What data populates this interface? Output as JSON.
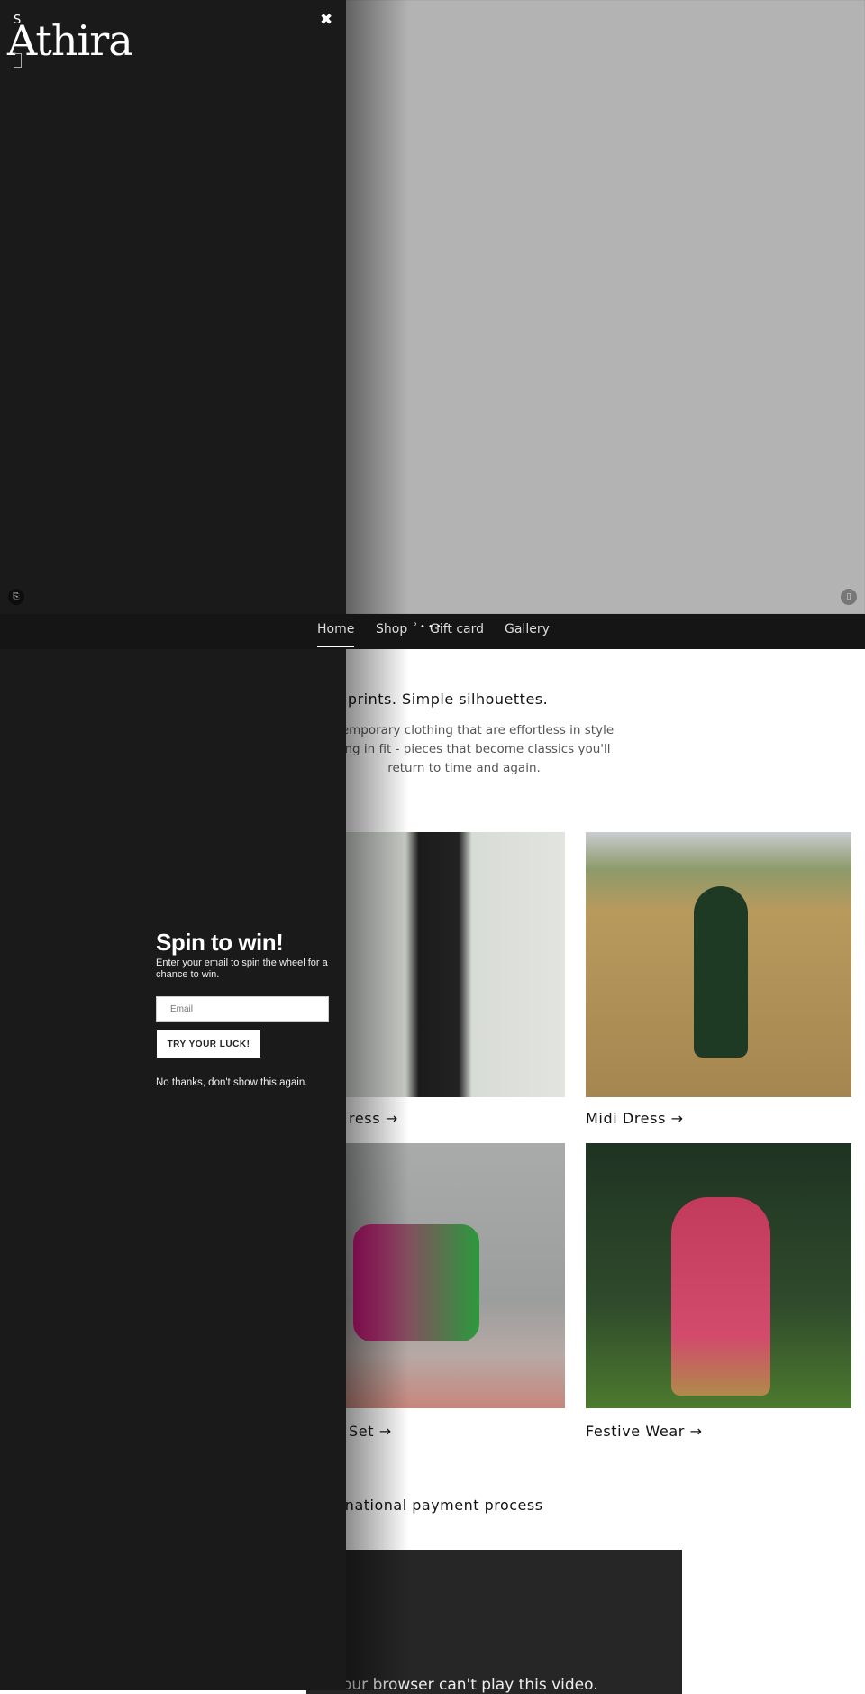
{
  "drawer": {
    "logo": "Athira",
    "s_mark": "S",
    "close_label": "✖",
    "icon_label": "⎘"
  },
  "hero": {
    "button_label": "▯"
  },
  "nav": {
    "items": [
      {
        "label": "Home",
        "active": true
      },
      {
        "label": "Shop"
      },
      {
        "label": "Gift card"
      },
      {
        "label": "Gallery"
      }
    ],
    "dots": "°•••"
  },
  "intro": {
    "heading": "e prints. Simple silhouettes.",
    "lines": [
      "emporary clothing that are effortless in style",
      "ng in fit - pieces that become classics you'll",
      "return to time and again."
    ]
  },
  "collections": [
    {
      "label": "ress →"
    },
    {
      "label": "Midi Dress →"
    },
    {
      "label": "Set →"
    },
    {
      "label": "Festive Wear →"
    }
  ],
  "payment": {
    "heading": "rnational payment process"
  },
  "video": {
    "fallback": "our browser can't play this video."
  },
  "popup": {
    "title": "Spin to win!",
    "subtitle": "Enter your email to spin the wheel for a chance to win.",
    "email_placeholder": "Email",
    "button_label": "TRY YOUR LUCK!",
    "dismiss": "No thanks, don't show this again."
  }
}
